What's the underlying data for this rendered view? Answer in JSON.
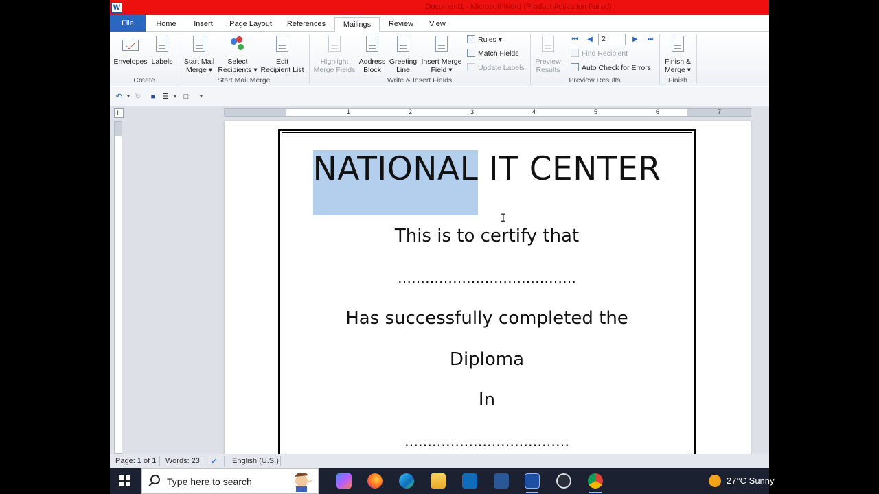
{
  "app": {
    "logo_letter": "W",
    "title": "Document1 - Microsoft Word (Product Activation Failed)"
  },
  "tabs": [
    "File",
    "Home",
    "Insert",
    "Page Layout",
    "References",
    "Mailings",
    "Review",
    "View"
  ],
  "active_tab": "Mailings",
  "ribbon": {
    "create": {
      "label": "Create",
      "envelopes": "Envelopes",
      "labels": "Labels"
    },
    "start_mail_merge": {
      "label": "Start Mail Merge",
      "start_line1": "Start Mail",
      "start_line2": "Merge ▾",
      "select_line1": "Select",
      "select_line2": "Recipients ▾",
      "edit_line1": "Edit",
      "edit_line2": "Recipient List"
    },
    "write_insert": {
      "label": "Write & Insert Fields",
      "highlight_line1": "Highlight",
      "highlight_line2": "Merge Fields",
      "address_line1": "Address",
      "address_line2": "Block",
      "greeting_line1": "Greeting",
      "greeting_line2": "Line",
      "insert_line1": "Insert Merge",
      "insert_line2": "Field ▾",
      "rules": "Rules ▾",
      "match_fields": "Match Fields",
      "update_labels": "Update Labels"
    },
    "preview": {
      "label": "Preview Results",
      "preview_line1": "Preview",
      "preview_line2": "Results",
      "record_number": "2",
      "find_recipient": "Find Recipient",
      "auto_check": "Auto Check for Errors"
    },
    "finish": {
      "label": "Finish",
      "finish_line1": "Finish &",
      "finish_line2": "Merge ▾"
    }
  },
  "ruler": {
    "horizontal_numbers": [
      "1",
      "2",
      "3",
      "4",
      "5",
      "6",
      "7"
    ],
    "corner_glyph": "L"
  },
  "document": {
    "heading_selected": "NATIONAL",
    "heading_rest": " IT CENTER",
    "line_certify": "This is to certify that",
    "dots_1": "…………………………………",
    "line_completed": "Has successfully completed the",
    "line_diploma": "Diploma",
    "line_in": "In",
    "dots_2": "………………………………",
    "cursor_glyph": "I"
  },
  "statusbar": {
    "page": "Page: 1 of 1",
    "words": "Words: 23",
    "language": "English (U.S.)"
  },
  "taskbar": {
    "search_placeholder": "Type here to search",
    "weather": "27°C  Sunny"
  },
  "colors": {
    "title_bar": "#ee0f0f",
    "file_tab": "#2a67c0",
    "selection": "#b4cfee",
    "taskbar": "#1b2130"
  }
}
